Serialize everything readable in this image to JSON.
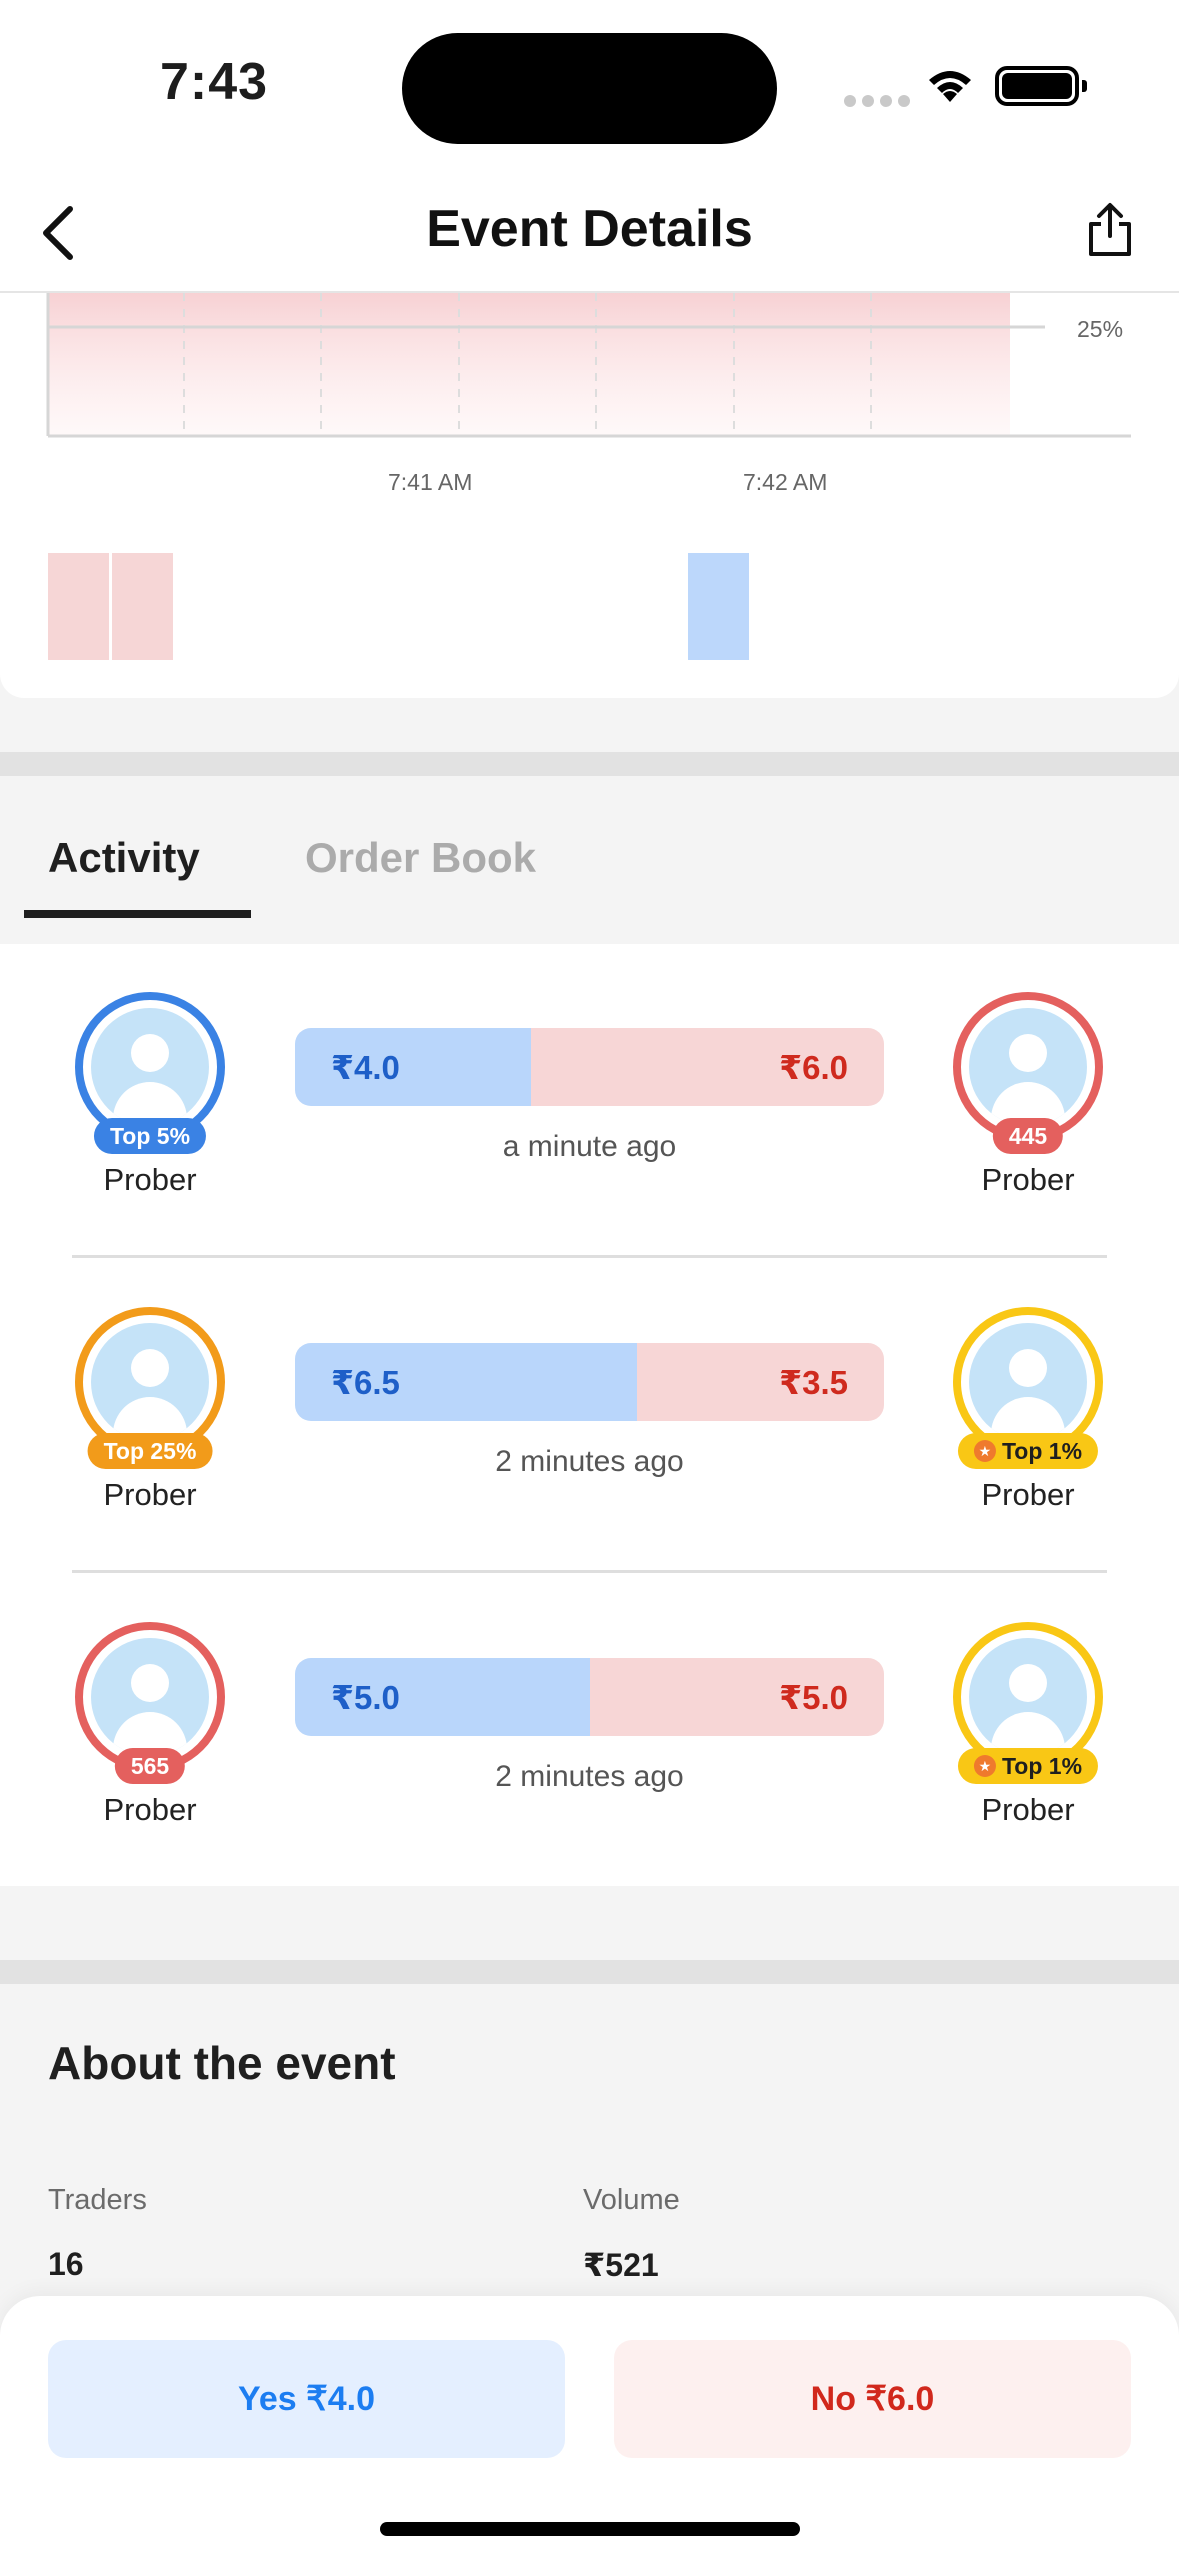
{
  "status_bar": {
    "time": "7:43"
  },
  "header": {
    "title": "Event Details"
  },
  "chart": {
    "percent_label": "25%",
    "time_labels": [
      "7:41 AM",
      "7:42 AM"
    ]
  },
  "tabs": [
    {
      "label": "Activity",
      "selected": true
    },
    {
      "label": "Order Book",
      "selected": false
    }
  ],
  "activity": [
    {
      "left": {
        "badge": "Top 5%",
        "name": "Prober",
        "ring_color": "#3a82e4",
        "badge_color": "#3a82e4",
        "star": false
      },
      "yes_price": "₹4.0",
      "no_price": "₹6.0",
      "yes_fraction": 0.4,
      "time_ago": "a minute ago",
      "right": {
        "badge": "445",
        "name": "Prober",
        "ring_color": "#e4605e",
        "badge_color": "#e4605e",
        "star": false
      }
    },
    {
      "left": {
        "badge": "Top 25%",
        "name": "Prober",
        "ring_color": "#f29b1a",
        "badge_color": "#f29b1a",
        "star": false
      },
      "yes_price": "₹6.5",
      "no_price": "₹3.5",
      "yes_fraction": 0.65,
      "time_ago": "2 minutes ago",
      "right": {
        "badge": "Top 1%",
        "name": "Prober",
        "ring_color": "#f9c715",
        "badge_color": "#f9c715",
        "star": true
      }
    },
    {
      "left": {
        "badge": "565",
        "name": "Prober",
        "ring_color": "#e4605e",
        "badge_color": "#e4605e",
        "star": false
      },
      "yes_price": "₹5.0",
      "no_price": "₹5.0",
      "yes_fraction": 0.5,
      "time_ago": "2 minutes ago",
      "right": {
        "badge": "Top 1%",
        "name": "Prober",
        "ring_color": "#f9c715",
        "badge_color": "#f9c715",
        "star": true
      }
    }
  ],
  "about": {
    "title": "About the event",
    "traders_label": "Traders",
    "traders_value": "16",
    "volume_label": "Volume",
    "volume_value": "₹521"
  },
  "actions": {
    "yes_label": "Yes ₹4.0",
    "no_label": "No ₹6.0"
  },
  "colors": {
    "yes_blue": "#1c7df1",
    "no_red": "#d1281c"
  }
}
